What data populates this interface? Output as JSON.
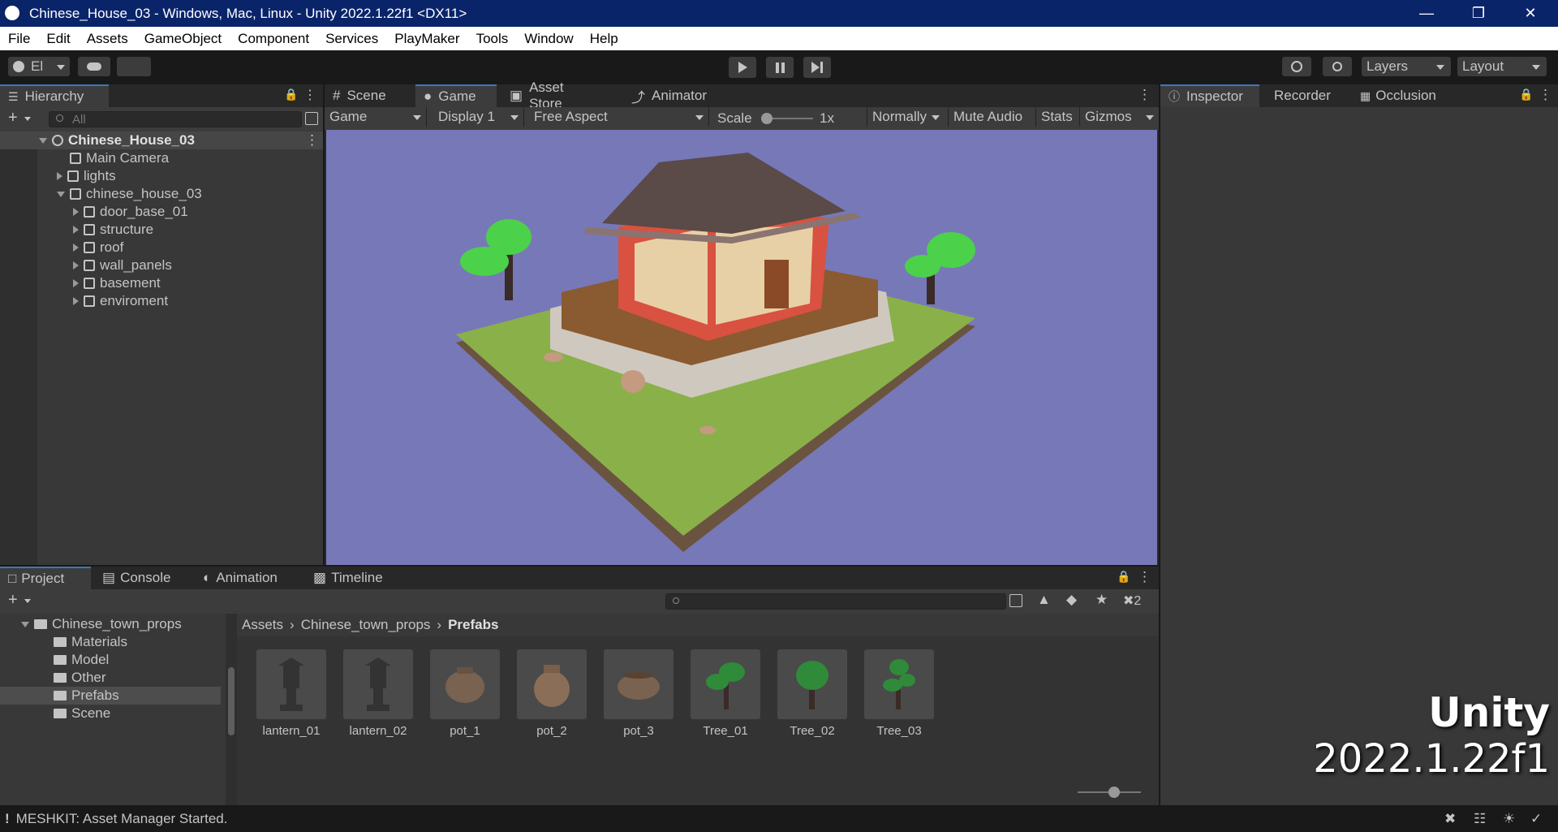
{
  "window": {
    "title": "Chinese_House_03 - Windows, Mac, Linux - Unity 2022.1.22f1 <DX11>"
  },
  "menu": [
    "File",
    "Edit",
    "Assets",
    "GameObject",
    "Component",
    "Services",
    "PlayMaker",
    "Tools",
    "Window",
    "Help"
  ],
  "toolbar": {
    "account_label": "El",
    "layers_label": "Layers",
    "layout_label": "Layout"
  },
  "hierarchy": {
    "tab": "Hierarchy",
    "search_placeholder": "All",
    "scene_root": "Chinese_House_03",
    "items": [
      {
        "label": "Main Camera",
        "depth": 1,
        "expand": "none"
      },
      {
        "label": "lights",
        "depth": 1,
        "expand": "collapsed"
      },
      {
        "label": "chinese_house_03",
        "depth": 1,
        "expand": "expanded"
      },
      {
        "label": "door_base_01",
        "depth": 2,
        "expand": "collapsed"
      },
      {
        "label": "structure",
        "depth": 2,
        "expand": "collapsed"
      },
      {
        "label": "roof",
        "depth": 2,
        "expand": "collapsed"
      },
      {
        "label": "wall_panels",
        "depth": 2,
        "expand": "collapsed"
      },
      {
        "label": "basement",
        "depth": 2,
        "expand": "collapsed"
      },
      {
        "label": "enviroment",
        "depth": 2,
        "expand": "collapsed"
      }
    ]
  },
  "center_tabs": [
    "Scene",
    "Game",
    "Asset Store",
    "Animator"
  ],
  "game_toolbar": {
    "view": "Game",
    "display": "Display 1",
    "aspect": "Free Aspect",
    "scale_label": "Scale",
    "scale_value": "1x",
    "mode": "Normally",
    "mute": "Mute Audio",
    "stats": "Stats",
    "gizmos": "Gizmos"
  },
  "right_tabs": [
    "Inspector",
    "Recorder",
    "Occlusion"
  ],
  "bottom_tabs": [
    "Project",
    "Console",
    "Animation",
    "Timeline"
  ],
  "project_tree": {
    "root": "Chinese_town_props",
    "folders": [
      "Materials",
      "Model",
      "Other",
      "Prefabs",
      "Scene"
    ],
    "selected": "Prefabs"
  },
  "breadcrumb": [
    "Assets",
    "Chinese_town_props",
    "Prefabs"
  ],
  "hidden_count": "2",
  "assets": [
    {
      "name": "lantern_01",
      "kind": "lantern"
    },
    {
      "name": "lantern_02",
      "kind": "lantern"
    },
    {
      "name": "pot_1",
      "kind": "pot"
    },
    {
      "name": "pot_2",
      "kind": "pot"
    },
    {
      "name": "pot_3",
      "kind": "pot"
    },
    {
      "name": "Tree_01",
      "kind": "tree"
    },
    {
      "name": "Tree_02",
      "kind": "tree"
    },
    {
      "name": "Tree_03",
      "kind": "tree"
    }
  ],
  "watermark": {
    "line1": "Unity",
    "line2": "2022.1.22f1"
  },
  "status": {
    "message": "MESHKIT: Asset Manager Started."
  },
  "colors": {
    "accent": "#3a79bb",
    "sky": "#7778b8",
    "grass": "#8ab04a",
    "titlebar": "#0a246a"
  }
}
